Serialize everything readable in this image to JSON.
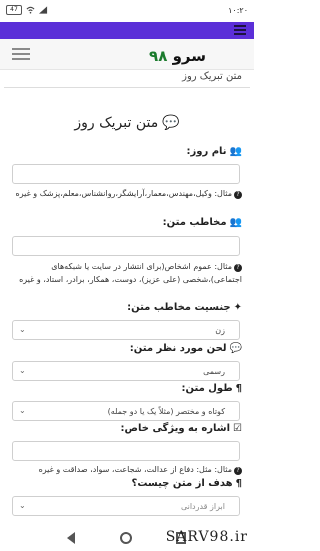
{
  "status": {
    "time": "۱۰:۲۰",
    "battery": "47"
  },
  "brand": {
    "word": "سرو",
    "num": "۹۸"
  },
  "breadcrumb": "متن تبریک روز",
  "heading": "متن تبریک روز",
  "fields": {
    "day_name_label": "نام روز:",
    "day_name_hint": "مثال: وکیل،مهندس،معمار،آرایشگر،روانشناس،معلم،پزشک و غیره",
    "audience_label": "مخاطب متن:",
    "audience_hint": "مثال: عموم اشخاص(برای انتشار در سایت یا شبکه‌های اجتماعی)،شخصی (علی عزیز)، دوست، همکار، برادر، استاد، و غیره",
    "gender_label": "جنسیت مخاطب متن:",
    "gender_value": "زن",
    "tone_label": "لحن مورد نظر متن:",
    "tone_value": "رسمی",
    "length_label": "طول متن:",
    "length_value": "کوتاه و مختصر (مثلاً یک یا دو جمله)",
    "feature_label": "اشاره به ویژگی خاص:",
    "feature_hint": "مثال: مثل: دفاع از عدالت، شجاعت، سواد، صداقت و غیره",
    "goal_label": "هدف از متن چیست؟",
    "goal_value": "ابراز قدردانی"
  },
  "watermark": "SARV98.ir"
}
